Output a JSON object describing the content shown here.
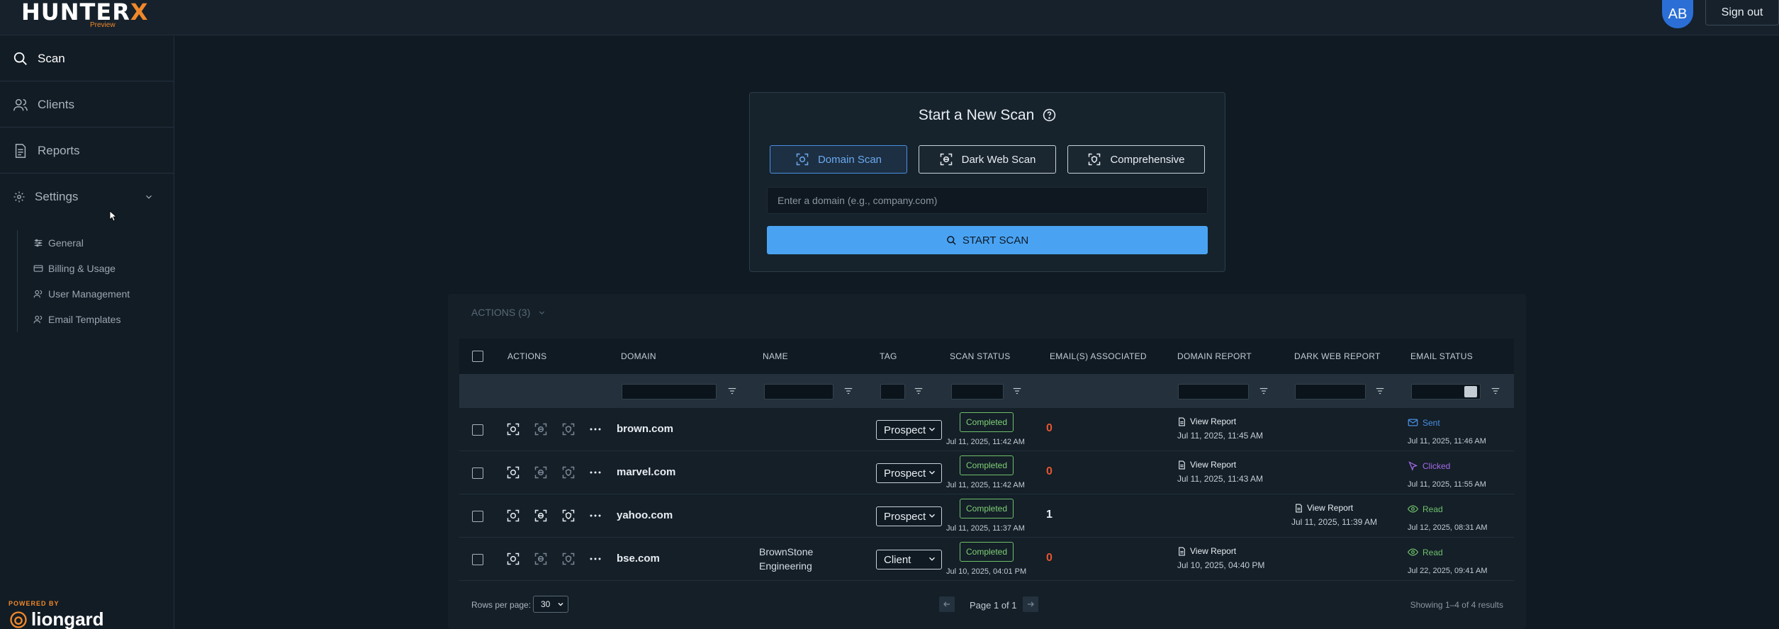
{
  "app": {
    "logo_text": "HUNTER",
    "logo_x": "X",
    "logo_sub": "Preview",
    "avatar_initials": "AB",
    "sign_out": "Sign out"
  },
  "sidebar": {
    "items": [
      {
        "label": "Scan",
        "icon": "search-icon"
      },
      {
        "label": "Clients",
        "icon": "users-icon"
      },
      {
        "label": "Reports",
        "icon": "document-icon"
      },
      {
        "label": "Settings",
        "icon": "gear-icon"
      }
    ],
    "settings_sub": [
      {
        "label": "General",
        "icon": "sliders-icon"
      },
      {
        "label": "Billing & Usage",
        "icon": "card-icon"
      },
      {
        "label": "User Management",
        "icon": "users-icon"
      },
      {
        "label": "Email Templates",
        "icon": "users-icon"
      }
    ],
    "powered_by": "POWERED BY",
    "brand": "liongard"
  },
  "scan_card": {
    "title": "Start a New Scan",
    "tabs": [
      {
        "label": "Domain Scan",
        "active": true
      },
      {
        "label": "Dark Web Scan",
        "active": false
      },
      {
        "label": "Comprehensive",
        "active": false
      }
    ],
    "placeholder": "Enter a domain (e.g., company.com)",
    "button": "START SCAN"
  },
  "table": {
    "actions_menu": "ACTIONS (3)",
    "headers": [
      "ACTIONS",
      "DOMAIN",
      "NAME",
      "TAG",
      "SCAN STATUS",
      "EMAIL(S) ASSOCIATED",
      "DOMAIN REPORT",
      "DARK WEB REPORT",
      "EMAIL STATUS"
    ],
    "rows": [
      {
        "domain": "brown.com",
        "name": "",
        "tag": "Prospect",
        "status": "Completed",
        "status_time": "Jul 11, 2025, 11:42 AM",
        "emails": "0",
        "emails_color": "#e8542f",
        "domain_report": "View Report",
        "domain_report_time": "Jul 11, 2025, 11:45 AM",
        "dark_report": "",
        "dark_report_time": "",
        "email_status": "Sent",
        "email_status_color": "#4a90e2",
        "email_status_icon": "mail-icon",
        "email_time": "Jul 11, 2025, 11:46 AM"
      },
      {
        "domain": "marvel.com",
        "name": "",
        "tag": "Prospect",
        "status": "Completed",
        "status_time": "Jul 11, 2025, 11:42 AM",
        "emails": "0",
        "emails_color": "#e8542f",
        "domain_report": "View Report",
        "domain_report_time": "Jul 11, 2025, 11:43 AM",
        "dark_report": "",
        "dark_report_time": "",
        "email_status": "Clicked",
        "email_status_color": "#a56ae8",
        "email_status_icon": "cursor-click-icon",
        "email_time": "Jul 11, 2025, 11:55 AM"
      },
      {
        "domain": "yahoo.com",
        "name": "",
        "tag": "Prospect",
        "status": "Completed",
        "status_time": "Jul 11, 2025, 11:37 AM",
        "emails": "1",
        "emails_color": "#e8edf2",
        "domain_report": "",
        "domain_report_time": "",
        "dark_report": "View Report",
        "dark_report_time": "Jul 11, 2025, 11:39 AM",
        "email_status": "Read",
        "email_status_color": "#6fbf6a",
        "email_status_icon": "eye-icon",
        "email_time": "Jul 12, 2025, 08:31 AM"
      },
      {
        "domain": "bse.com",
        "name_line1": "BrownStone",
        "name_line2": "Engineering",
        "tag": "Client",
        "status": "Completed",
        "status_time": "Jul 10, 2025, 04:01 PM",
        "emails": "0",
        "emails_color": "#e8542f",
        "domain_report": "View Report",
        "domain_report_time": "Jul 10, 2025, 04:40 PM",
        "dark_report": "",
        "dark_report_time": "",
        "email_status": "Read",
        "email_status_color": "#6fbf6a",
        "email_status_icon": "eye-icon",
        "email_time": "Jul 22, 2025, 09:41 AM"
      }
    ],
    "rows_per_page_label": "Rows per page:",
    "rows_per_page": "30",
    "page_info": "Page 1 of 1",
    "showing": "Showing 1–4 of 4 results"
  }
}
